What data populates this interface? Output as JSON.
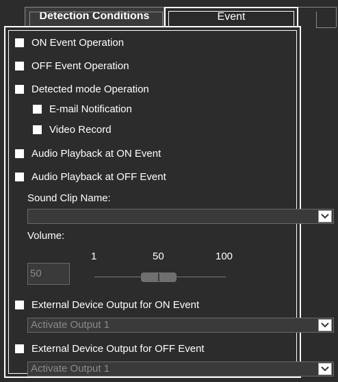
{
  "tabs": {
    "detection_label": "Detection Conditions",
    "event_label": "Event"
  },
  "options": {
    "on_event_operation": "ON Event Operation",
    "off_event_operation": "OFF Event Operation",
    "detected_mode_operation": "Detected mode Operation",
    "email_notification": "E-mail Notification",
    "video_record": "Video Record",
    "audio_on_event": "Audio Playback at ON Event",
    "audio_off_event": "Audio Playback at OFF Event",
    "external_on_event": "External Device Output for ON Event",
    "external_off_event": "External Device Output for OFF Event"
  },
  "sound_clip": {
    "label": "Sound Clip Name:",
    "value": ""
  },
  "volume": {
    "label": "Volume:",
    "value": "50",
    "tick_min": "1",
    "tick_mid": "50",
    "tick_max": "100",
    "level": 50
  },
  "external_on_select": {
    "value": "Activate Output 1"
  },
  "external_off_select": {
    "value": "Activate Output 1"
  },
  "icons": {
    "checkbox": "checkbox-unchecked-icon",
    "dropdown": "chevron-down-icon"
  },
  "colors": {
    "panel_bg": "#2c2c2c",
    "text": "#ffffff",
    "disabled_text": "#8a8a8a"
  }
}
